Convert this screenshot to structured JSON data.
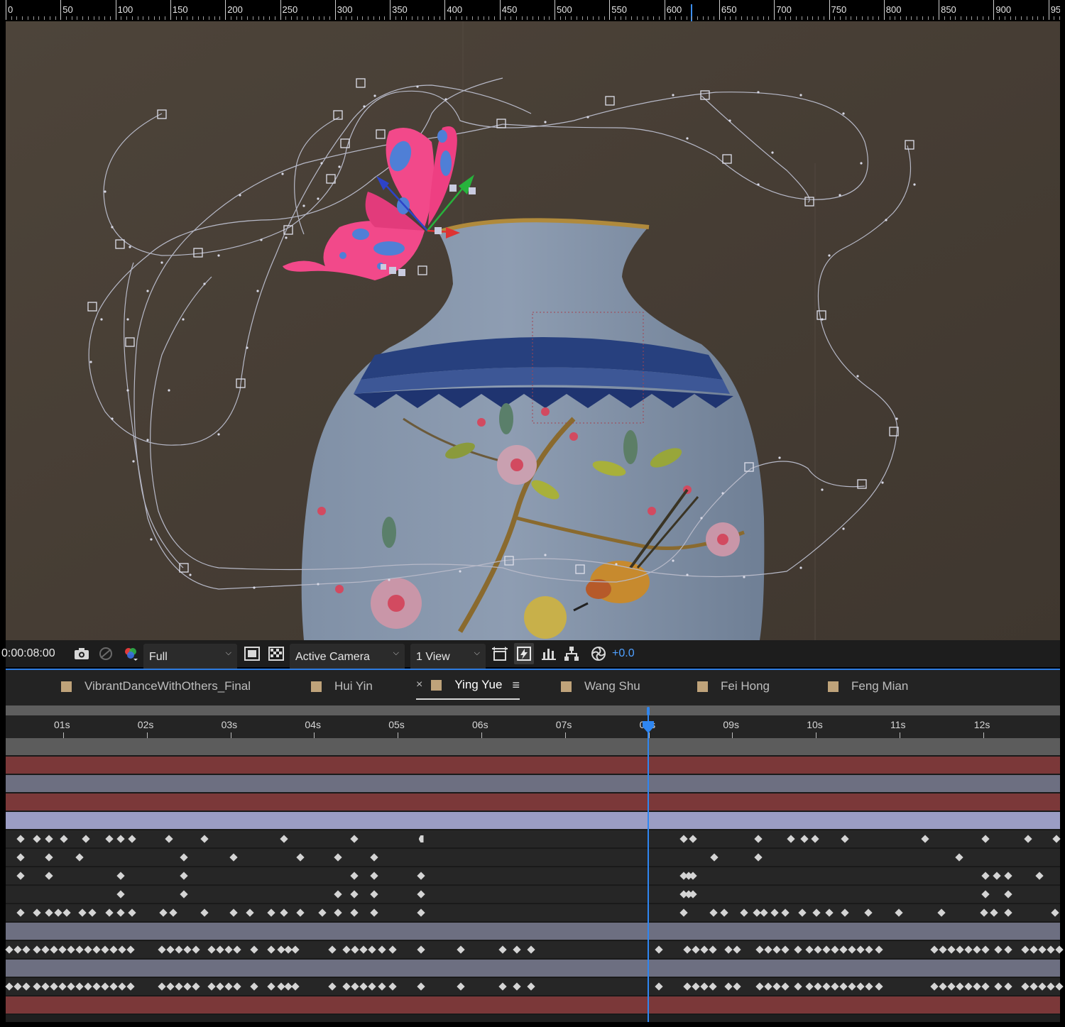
{
  "ruler": {
    "labels": [
      "0",
      "50",
      "100",
      "150",
      "200",
      "250",
      "300",
      "350",
      "400",
      "450",
      "500",
      "550",
      "600",
      "650",
      "700",
      "750",
      "800",
      "850",
      "900",
      "95"
    ]
  },
  "viewer": {
    "paper_color": "#4a4138",
    "vase_color": "#7d8ea4",
    "butterfly_color": "#f2498a",
    "accent_blue": "#4f7fd6"
  },
  "toolbar": {
    "timecode": "0:00:08:00",
    "resolution": "Full",
    "camera": "Active Camera",
    "views": "1 View",
    "exposure": "+0.0",
    "icons": [
      "snapshot-icon",
      "show-snapshot-icon",
      "color-channels-icon",
      "region-of-interest-icon",
      "transparency-grid-icon",
      "reset-3d-view-icon",
      "fast-previews-icon",
      "timeline-icon",
      "flowchart-icon",
      "exposure-icon"
    ]
  },
  "tabs": [
    {
      "label": "VibrantDanceWithOthers_Final",
      "active": false
    },
    {
      "label": "Hui Yin",
      "active": false
    },
    {
      "label": "Ying Yue",
      "active": true
    },
    {
      "label": "Wang Shu",
      "active": false
    },
    {
      "label": "Fei Hong",
      "active": false
    },
    {
      "label": "Feng Mian",
      "active": false
    }
  ],
  "timeline": {
    "time_labels": [
      "01s",
      "02s",
      "03s",
      "04s",
      "05s",
      "06s",
      "07s",
      "08s",
      "09s",
      "10s",
      "11s",
      "12s"
    ],
    "current_time_label": "08s",
    "playhead_color": "#2f86f0"
  }
}
